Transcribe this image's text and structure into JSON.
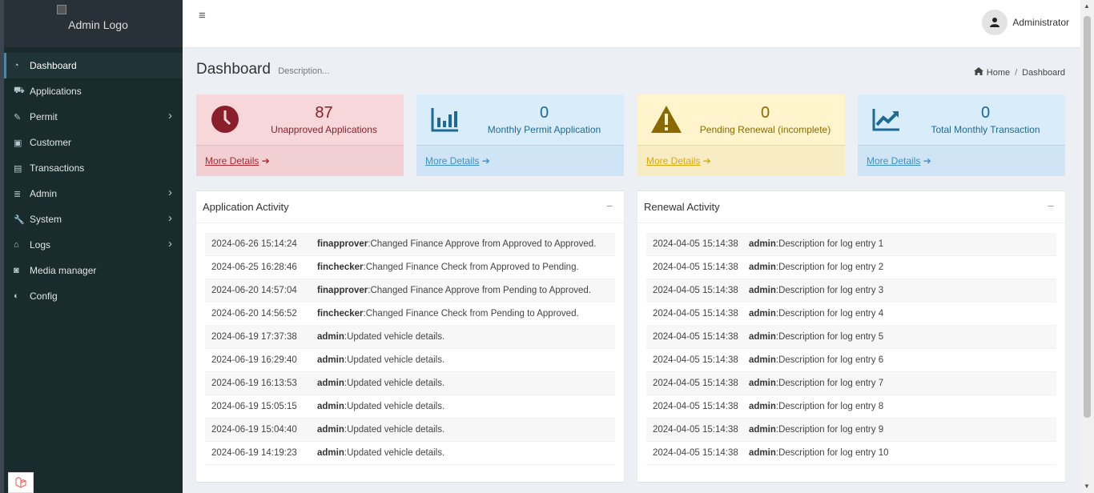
{
  "sidebar": {
    "logo_alt": "Admin Logo",
    "items": [
      {
        "label": "Dashboard",
        "icon": "dashboard-icon",
        "glyph": "◔",
        "arrow": false
      },
      {
        "label": "Applications",
        "icon": "car-icon",
        "glyph": "⛟",
        "arrow": false
      },
      {
        "label": "Permit",
        "icon": "edit-icon",
        "glyph": "✎",
        "arrow": true
      },
      {
        "label": "Customer",
        "icon": "address-book-icon",
        "glyph": "▣",
        "arrow": false
      },
      {
        "label": "Transactions",
        "icon": "print-icon",
        "glyph": "▤",
        "arrow": false
      },
      {
        "label": "Admin",
        "icon": "server-icon",
        "glyph": "≣",
        "arrow": true
      },
      {
        "label": "System",
        "icon": "wrench-icon",
        "glyph": "🔧",
        "arrow": true
      },
      {
        "label": "Logs",
        "icon": "bank-icon",
        "glyph": "⌂",
        "arrow": true
      },
      {
        "label": "Media manager",
        "icon": "camera-icon",
        "glyph": "◙",
        "arrow": false
      },
      {
        "label": "Config",
        "icon": "toggle-icon",
        "glyph": "◐",
        "arrow": false
      }
    ]
  },
  "header": {
    "user_name": "Administrator"
  },
  "page": {
    "title": "Dashboard",
    "description": "Description...",
    "breadcrumb_home": "Home",
    "breadcrumb_current": "Dashboard"
  },
  "stat_boxes": [
    {
      "value": "87",
      "label": "Unapproved Applications",
      "link": "More Details",
      "icon": "clock-icon",
      "color": "#8b1e2b",
      "bg_top": "#f8d7da",
      "bg_bottom": "#f1cfd3",
      "link_color": "#b4262f"
    },
    {
      "value": "0",
      "label": "Monthly Permit Application",
      "icon": "bar-chart-icon",
      "link": "More Details",
      "color": "#1d6a96",
      "bg_top": "#d9ecf9",
      "bg_bottom": "#cfe5f5",
      "link_color": "#3a8fd0"
    },
    {
      "value": "0",
      "label": "Pending Renewal (incomplete)",
      "icon": "warning-icon",
      "link": "More Details",
      "color": "#8a6a00",
      "bg_top": "#fff4cc",
      "bg_bottom": "#f8ecc4",
      "link_color": "#e0a800"
    },
    {
      "value": "0",
      "label": "Total Monthly Transaction",
      "icon": "trend-up-icon",
      "link": "More Details",
      "color": "#1d6a96",
      "bg_top": "#d9ecf9",
      "bg_bottom": "#cfe5f5",
      "link_color": "#3a8fd0"
    }
  ],
  "application_activity": {
    "title": "Application Activity",
    "rows": [
      {
        "time": "2024-06-26 15:14:24",
        "user": "finapprover",
        "text": ":Changed Finance Approve from Approved to Approved."
      },
      {
        "time": "2024-06-25 16:28:46",
        "user": "finchecker",
        "text": ":Changed Finance Check from Approved to Pending."
      },
      {
        "time": "2024-06-20 14:57:04",
        "user": "finapprover",
        "text": ":Changed Finance Approve from Pending to Approved."
      },
      {
        "time": "2024-06-20 14:56:52",
        "user": "finchecker",
        "text": ":Changed Finance Check from Pending to Approved."
      },
      {
        "time": "2024-06-19 17:37:38",
        "user": "admin",
        "text": ":Updated vehicle details."
      },
      {
        "time": "2024-06-19 16:29:40",
        "user": "admin",
        "text": ":Updated vehicle details."
      },
      {
        "time": "2024-06-19 16:13:53",
        "user": "admin",
        "text": ":Updated vehicle details."
      },
      {
        "time": "2024-06-19 15:05:15",
        "user": "admin",
        "text": ":Updated vehicle details."
      },
      {
        "time": "2024-06-19 15:04:40",
        "user": "admin",
        "text": ":Updated vehicle details."
      },
      {
        "time": "2024-06-19 14:19:23",
        "user": "admin",
        "text": ":Updated vehicle details."
      }
    ]
  },
  "renewal_activity": {
    "title": "Renewal Activity",
    "rows": [
      {
        "time": "2024-04-05 15:14:38",
        "user": "admin",
        "text": ":Description for log entry 1"
      },
      {
        "time": "2024-04-05 15:14:38",
        "user": "admin",
        "text": ":Description for log entry 2"
      },
      {
        "time": "2024-04-05 15:14:38",
        "user": "admin",
        "text": ":Description for log entry 3"
      },
      {
        "time": "2024-04-05 15:14:38",
        "user": "admin",
        "text": ":Description for log entry 4"
      },
      {
        "time": "2024-04-05 15:14:38",
        "user": "admin",
        "text": ":Description for log entry 5"
      },
      {
        "time": "2024-04-05 15:14:38",
        "user": "admin",
        "text": ":Description for log entry 6"
      },
      {
        "time": "2024-04-05 15:14:38",
        "user": "admin",
        "text": ":Description for log entry 7"
      },
      {
        "time": "2024-04-05 15:14:38",
        "user": "admin",
        "text": ":Description for log entry 8"
      },
      {
        "time": "2024-04-05 15:14:38",
        "user": "admin",
        "text": ":Description for log entry 9"
      },
      {
        "time": "2024-04-05 15:14:38",
        "user": "admin",
        "text": ":Description for log entry 10"
      }
    ]
  }
}
